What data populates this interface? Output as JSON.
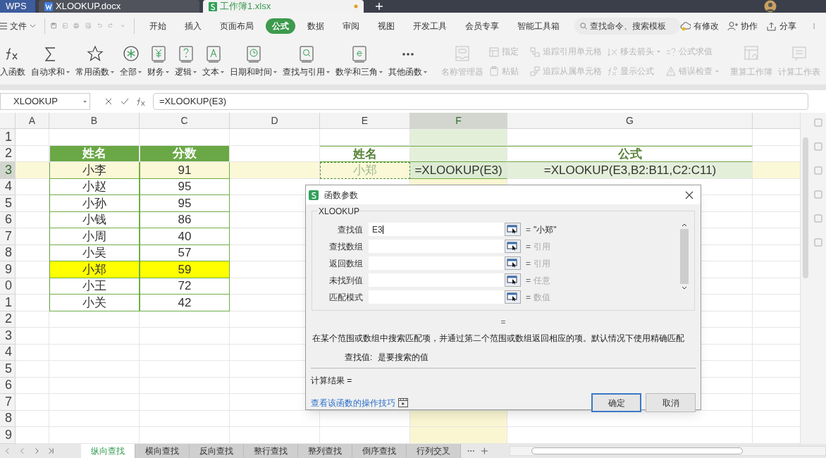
{
  "title_tabs": [
    {
      "label": "WPS",
      "kind": "brand",
      "selected": false,
      "unsaved": false
    },
    {
      "label": "XLOOKUP.docx",
      "kind": "doc",
      "selected": false,
      "unsaved": false
    },
    {
      "label": "工作簿1.xlsx",
      "kind": "sheet",
      "selected": true,
      "unsaved": true
    }
  ],
  "menu": {
    "file": "文件",
    "tabs": [
      {
        "label": "开始",
        "selected": false
      },
      {
        "label": "插入",
        "selected": false
      },
      {
        "label": "页面布局",
        "selected": false
      },
      {
        "label": "公式",
        "selected": true
      },
      {
        "label": "数据",
        "selected": false
      },
      {
        "label": "审阅",
        "selected": false
      },
      {
        "label": "视图",
        "selected": false
      },
      {
        "label": "开发工具",
        "selected": false
      },
      {
        "label": "会员专享",
        "selected": false
      },
      {
        "label": "智能工具箱",
        "selected": false
      }
    ],
    "search": {
      "placeholder": "查找命令、搜索模板"
    },
    "actions": [
      {
        "label": "有修改",
        "kind": "cloud"
      },
      {
        "label": "协作",
        "kind": "person"
      },
      {
        "label": "分享",
        "kind": "share"
      }
    ]
  },
  "ribbon": {
    "functions": [
      {
        "label": "入函数",
        "kind": "fx",
        "dropdown": false
      },
      {
        "label": "自动求和",
        "kind": "sigma",
        "dropdown": true
      },
      {
        "label": "常用函数",
        "kind": "star",
        "dropdown": true
      },
      {
        "label": "全部",
        "kind": "asterisk",
        "dropdown": true
      },
      {
        "label": "财务",
        "kind": "yen",
        "dropdown": true
      },
      {
        "label": "逻辑",
        "kind": "question",
        "dropdown": true
      },
      {
        "label": "文本",
        "kind": "letter",
        "dropdown": true
      },
      {
        "label": "日期和时间",
        "kind": "clock",
        "dropdown": true
      },
      {
        "label": "查找与引用",
        "kind": "search",
        "dropdown": true
      },
      {
        "label": "数学和三角",
        "kind": "e",
        "dropdown": true
      },
      {
        "label": "其他函数",
        "kind": "dots",
        "dropdown": true
      }
    ],
    "names": {
      "big": "名称管理器",
      "small": [
        "指定",
        "粘贴"
      ],
      "disabled": true
    },
    "audit": {
      "rows": [
        [
          "追踪引用单元格",
          "移去箭头",
          "公式求值"
        ],
        [
          "追踪从属单元格",
          "显示公式",
          "错误检查"
        ]
      ],
      "disabled": true
    },
    "calc": {
      "items": [
        "重算工作簿",
        "计算工作表"
      ],
      "disabled": true
    }
  },
  "formula_bar": {
    "name_box": "XLOOKUP",
    "formula": "=XLOOKUP(E3)"
  },
  "sheet": {
    "columns": [
      {
        "label": "A",
        "selected": false
      },
      {
        "label": "B",
        "selected": false
      },
      {
        "label": "C",
        "selected": false
      },
      {
        "label": "D",
        "selected": false
      },
      {
        "label": "E",
        "selected": false
      },
      {
        "label": "F",
        "selected": true
      },
      {
        "label": "G",
        "selected": false
      }
    ],
    "row_headers": [
      {
        "label": "1",
        "selected": false
      },
      {
        "label": "2",
        "selected": false
      },
      {
        "label": "3",
        "selected": true
      },
      {
        "label": "4",
        "selected": false
      },
      {
        "label": "5",
        "selected": false
      },
      {
        "label": "6",
        "selected": false
      },
      {
        "label": "7",
        "selected": false
      },
      {
        "label": "8",
        "selected": false
      },
      {
        "label": "9",
        "selected": false
      },
      {
        "label": "0",
        "selected": false
      },
      {
        "label": "1",
        "selected": false
      },
      {
        "label": "2",
        "selected": false
      },
      {
        "label": "3",
        "selected": false
      },
      {
        "label": "4",
        "selected": false
      },
      {
        "label": "5",
        "selected": false
      },
      {
        "label": "6",
        "selected": false
      },
      {
        "label": "7",
        "selected": false
      },
      {
        "label": "8",
        "selected": false
      },
      {
        "label": "9",
        "selected": false
      }
    ],
    "score_table": {
      "columns": [
        "姓名",
        "分数"
      ],
      "rows": [
        {
          "name": "小李",
          "score": "91",
          "highlighted": false
        },
        {
          "name": "小赵",
          "score": "95",
          "highlighted": false
        },
        {
          "name": "小孙",
          "score": "95",
          "highlighted": false
        },
        {
          "name": "小钱",
          "score": "86",
          "highlighted": false
        },
        {
          "name": "小周",
          "score": "40",
          "highlighted": false
        },
        {
          "name": "小吴",
          "score": "57",
          "highlighted": false
        },
        {
          "name": "小郑",
          "score": "59",
          "highlighted": true
        },
        {
          "name": "小王",
          "score": "72",
          "highlighted": false
        },
        {
          "name": "小关",
          "score": "42",
          "highlighted": false
        }
      ]
    },
    "lookup": {
      "name_header": "姓名",
      "formula_header": "公式",
      "lookup_value": "小郑",
      "result": "=XLOOKUP(E3)",
      "formula": "=XLOOKUP(E3,B2:B11,C2:C11)"
    }
  },
  "dialog": {
    "title": "函数参数",
    "function": "XLOOKUP",
    "args": [
      {
        "label": "查找值",
        "value": "E3",
        "result": "\"小郑\"",
        "kind": "value"
      },
      {
        "label": "查找数组",
        "result": "引用",
        "kind": "hint"
      },
      {
        "label": "返回数组",
        "result": "引用",
        "kind": "hint"
      },
      {
        "label": "未找到值",
        "result": "任意",
        "kind": "hint"
      },
      {
        "label": "匹配模式",
        "result": "数值",
        "kind": "hint"
      }
    ],
    "equals": "=",
    "description": "在某个范围或数组中搜索匹配项，并通过第二个范围或数组返回相应的项。默认情况下使用精确匹配",
    "param_label": "查找值:",
    "param_description": "是要搜索的值",
    "result_label": "计算结果 =",
    "link": "查看该函数的操作技巧",
    "buttons": [
      {
        "label": "确定",
        "selected": true
      },
      {
        "label": "取消",
        "selected": false
      }
    ]
  },
  "sheet_tabs": [
    {
      "label": "纵向查找",
      "selected": true
    },
    {
      "label": "横向查找",
      "selected": false
    },
    {
      "label": "反向查找",
      "selected": false
    },
    {
      "label": "整行查找",
      "selected": false
    },
    {
      "label": "整列查找",
      "selected": false
    },
    {
      "label": "倒序查找",
      "selected": false
    },
    {
      "label": "行列交叉",
      "selected": false
    }
  ]
}
